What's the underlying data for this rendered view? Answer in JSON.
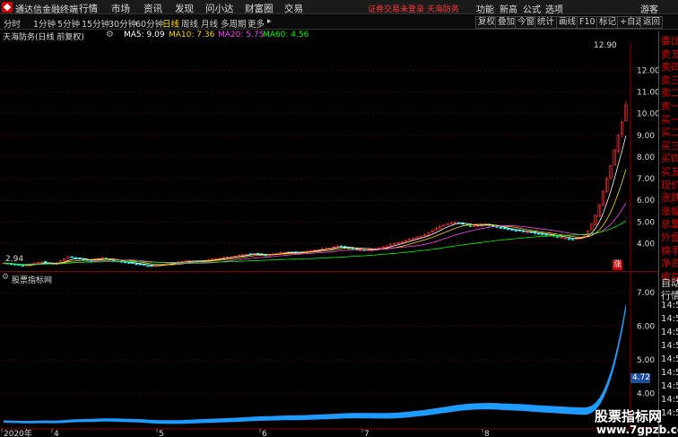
{
  "titlebar": {
    "app_title": "通达信金融终端",
    "menus": [
      "行情",
      "市场",
      "资讯",
      "发现",
      "问小达",
      "财富圈",
      "交易"
    ],
    "login_warning": "证券交易未登录  天海防务",
    "right_items": [
      "功能",
      "新高",
      "公式",
      "选项",
      "游客"
    ]
  },
  "toolbar": {
    "periods": [
      "分时",
      "1分钟",
      "5分钟",
      "15分钟",
      "30分钟",
      "60分钟",
      "日线",
      "周线",
      "月线",
      "多周期",
      "更多"
    ],
    "active_period": "日线",
    "buttons": [
      "复权",
      "叠加",
      "今窗",
      "统计",
      "画线",
      "F10",
      "标记",
      "+自选",
      "返回"
    ]
  },
  "indicator_line": {
    "title": "天海防务(日线 前复权)",
    "ma5": "MA5: 9.09",
    "ma10": "MA10: 7.36",
    "ma20": "MA20: 5.75",
    "ma60": "MA60: 4.56"
  },
  "main_chart": {
    "y_ticks": [
      "12.00",
      "11.00",
      "10.00",
      "9.00",
      "8.00",
      "7.00",
      "6.00",
      "5.00",
      "4.00"
    ],
    "high_label": "12.90",
    "low_label": "2.94",
    "limit_badge": "涨"
  },
  "sub_chart": {
    "title": "股票指标网",
    "y_ticks": [
      "7.00",
      "6.00",
      "5.00",
      "4.00"
    ],
    "current_value": "4.72"
  },
  "x_axis": {
    "labels": [
      "2020年",
      "4",
      "5",
      "6",
      "7",
      "8"
    ]
  },
  "quote_panel": {
    "labels": [
      "委比",
      "卖五",
      "卖四",
      "卖三",
      "卖二",
      "卖一",
      "买一",
      "买二",
      "买三",
      "买四",
      "买五",
      "现价",
      "涨跌",
      "涨幅",
      "总量",
      "外盘",
      "换手",
      "净资",
      "收益"
    ],
    "lower_labels": [
      "自动",
      "行情"
    ],
    "times": [
      "14:50",
      "14:50",
      "14:50",
      "14:50",
      "14:50",
      "14:50",
      "14:50",
      "14:50",
      "14:50"
    ]
  },
  "watermark": {
    "main": "股票指标网",
    "url": "www.7gpzb.com"
  },
  "colors": {
    "up": "#ff3333",
    "down": "#00ffff",
    "ma5": "#ffffff",
    "ma10": "#ffd700",
    "ma20": "#ff44ff",
    "ma60": "#00ff00",
    "indicator": "#1e9bff",
    "grid": "#8b0000"
  },
  "chart_data": {
    "type": "candlestick",
    "title": "天海防务(日线 前复权)",
    "ylim": [
      2.9,
      13.3
    ],
    "closes": [
      3.1,
      3.08,
      3.05,
      3.02,
      3.0,
      2.98,
      3.0,
      3.05,
      3.1,
      3.12,
      3.15,
      3.1,
      3.08,
      3.05,
      3.1,
      3.2,
      3.3,
      3.4,
      3.35,
      3.3,
      3.28,
      3.25,
      3.22,
      3.2,
      3.25,
      3.3,
      3.35,
      3.3,
      3.25,
      3.2,
      3.18,
      3.15,
      3.12,
      3.1,
      3.08,
      3.05,
      3.02,
      3.0,
      2.97,
      2.95,
      2.98,
      3.02,
      3.05,
      3.08,
      3.1,
      3.12,
      3.15,
      3.18,
      3.2,
      3.22,
      3.2,
      3.18,
      3.2,
      3.22,
      3.25,
      3.28,
      3.3,
      3.32,
      3.35,
      3.38,
      3.4,
      3.42,
      3.45,
      3.48,
      3.5,
      3.52,
      3.55,
      3.5,
      3.48,
      3.45,
      3.48,
      3.52,
      3.55,
      3.58,
      3.6,
      3.62,
      3.6,
      3.58,
      3.6,
      3.62,
      3.65,
      3.68,
      3.7,
      3.72,
      3.75,
      3.78,
      3.8,
      3.85,
      3.9,
      3.85,
      3.8,
      3.78,
      3.75,
      3.72,
      3.7,
      3.68,
      3.7,
      3.72,
      3.75,
      3.8,
      3.85,
      3.9,
      3.95,
      4.0,
      4.05,
      4.1,
      4.15,
      4.2,
      4.25,
      4.3,
      4.35,
      4.4,
      4.5,
      4.6,
      4.7,
      4.8,
      4.85,
      4.9,
      4.95,
      5.0,
      4.95,
      4.9,
      4.85,
      4.8,
      4.82,
      4.85,
      4.88,
      4.9,
      4.85,
      4.8,
      4.75,
      4.7,
      4.68,
      4.65,
      4.62,
      4.6,
      4.58,
      4.55,
      4.52,
      4.5,
      4.48,
      4.45,
      4.42,
      4.4,
      4.38,
      4.35,
      4.3,
      4.28,
      4.25,
      4.22,
      4.2,
      4.25,
      4.3,
      4.4,
      4.6,
      4.9,
      5.3,
      5.8,
      6.4,
      7.0,
      7.6,
      8.3,
      9.0,
      9.6,
      10.4
    ],
    "ma60_last": 4.56,
    "ma20_last": 5.75,
    "ma10_last": 7.36,
    "ma5_last": 9.09,
    "sub_indicator": {
      "name": "股票指标网",
      "last": 4.72,
      "ylim": [
        3.0,
        7.3
      ]
    }
  }
}
